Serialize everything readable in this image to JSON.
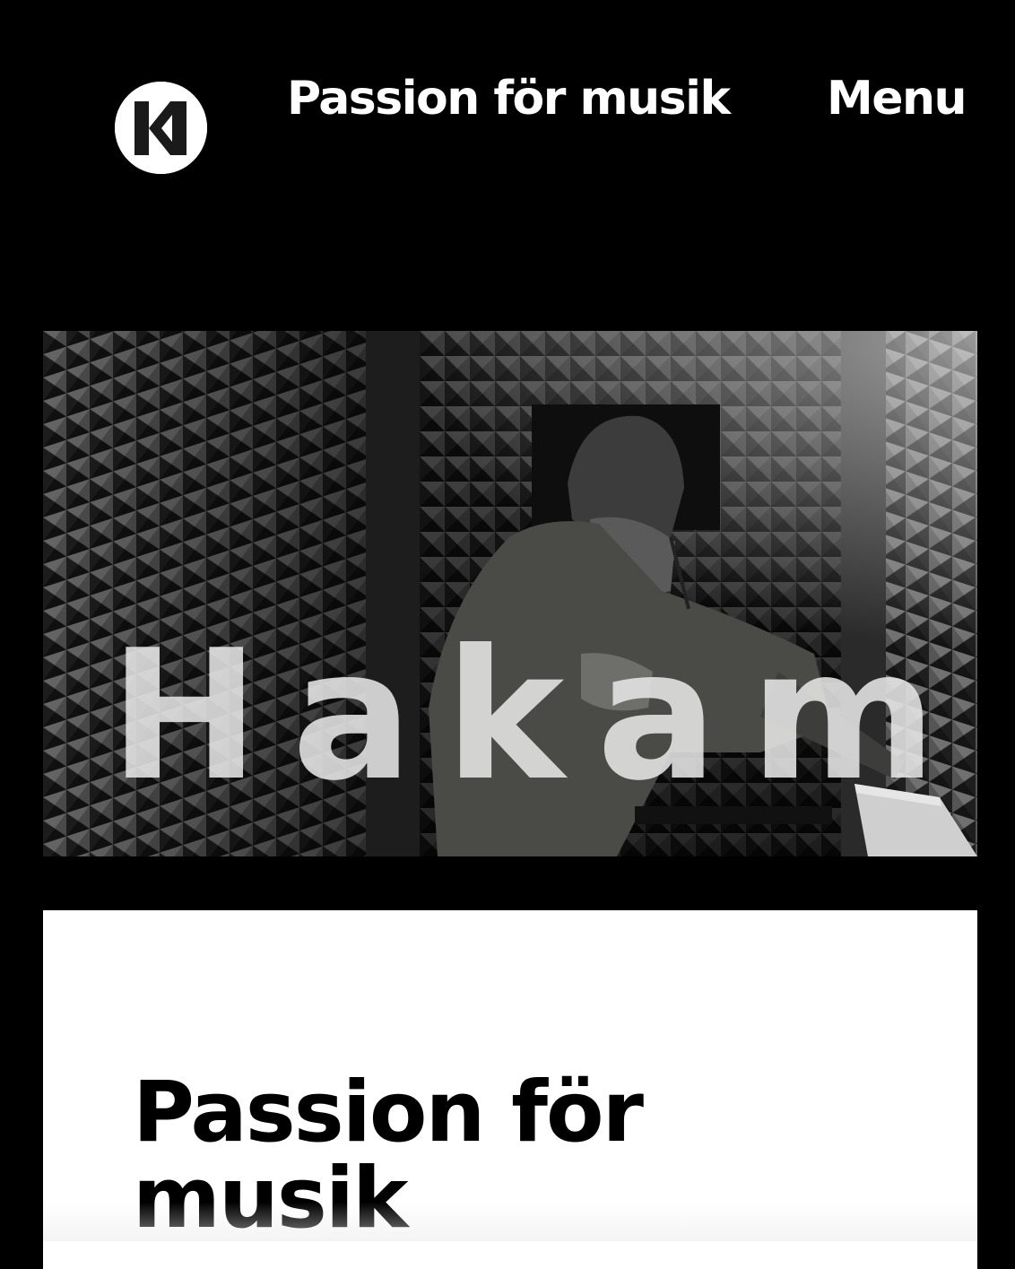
{
  "header": {
    "logo_icon": "hakami-logo-icon",
    "nav_passion_label": "Passion för musik",
    "menu_label": "Menu"
  },
  "hero": {
    "title": "Hakami",
    "image": "studio-photo"
  },
  "content": {
    "heading": "Passion för musik"
  },
  "colors": {
    "background": "#000000",
    "card": "#ffffff",
    "text_light": "#ffffff",
    "text_dark": "#000000"
  }
}
